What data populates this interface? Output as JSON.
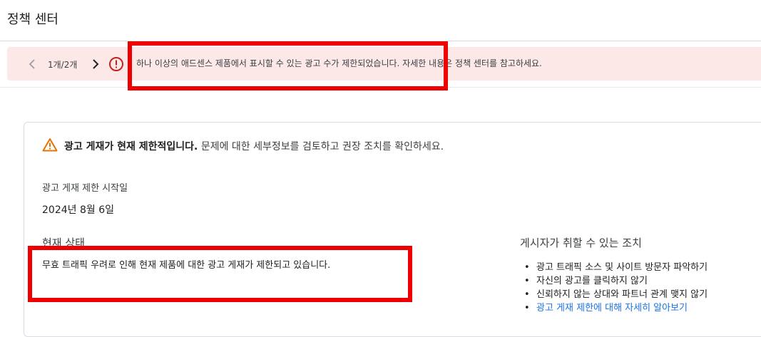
{
  "header": {
    "title": "정책 센터"
  },
  "alert": {
    "pager": "1개/2개",
    "message": "하나 이상의 애드센스 제품에서 표시할 수 있는 광고 수가 제한되었습니다. 자세한 내용은 정책 센터를 참고하세요."
  },
  "card": {
    "warning_bold": "광고 게재가 현재 제한적입니다.",
    "warning_rest": " 문제에 대한 세부정보를 검토하고 권장 조치를 확인하세요.",
    "start_label": "광고 게재 제한 시작일",
    "start_date": "2024년 8월 6일",
    "status_title": "현재 상태",
    "status_text": "무효 트래픽 우려로 인해 현재 제품에 대한 광고 게재가 제한되고 있습니다.",
    "actions_title": "게시자가 취할 수 있는 조치",
    "actions": [
      "광고 트래픽 소스 및 사이트 방문자 파악하기",
      "자신의 광고를 클릭하지 않기",
      "신뢰하지 않는 상대와 파트너 관계 맺지 않기",
      "광고 게재 제한에 대해 자세히 알아보기"
    ]
  },
  "colors": {
    "alert_bg": "#fce8e6",
    "error_red": "#c5221f",
    "warning_orange": "#e37400",
    "link_blue": "#1a73e8",
    "annotation_red": "#ee0000"
  }
}
